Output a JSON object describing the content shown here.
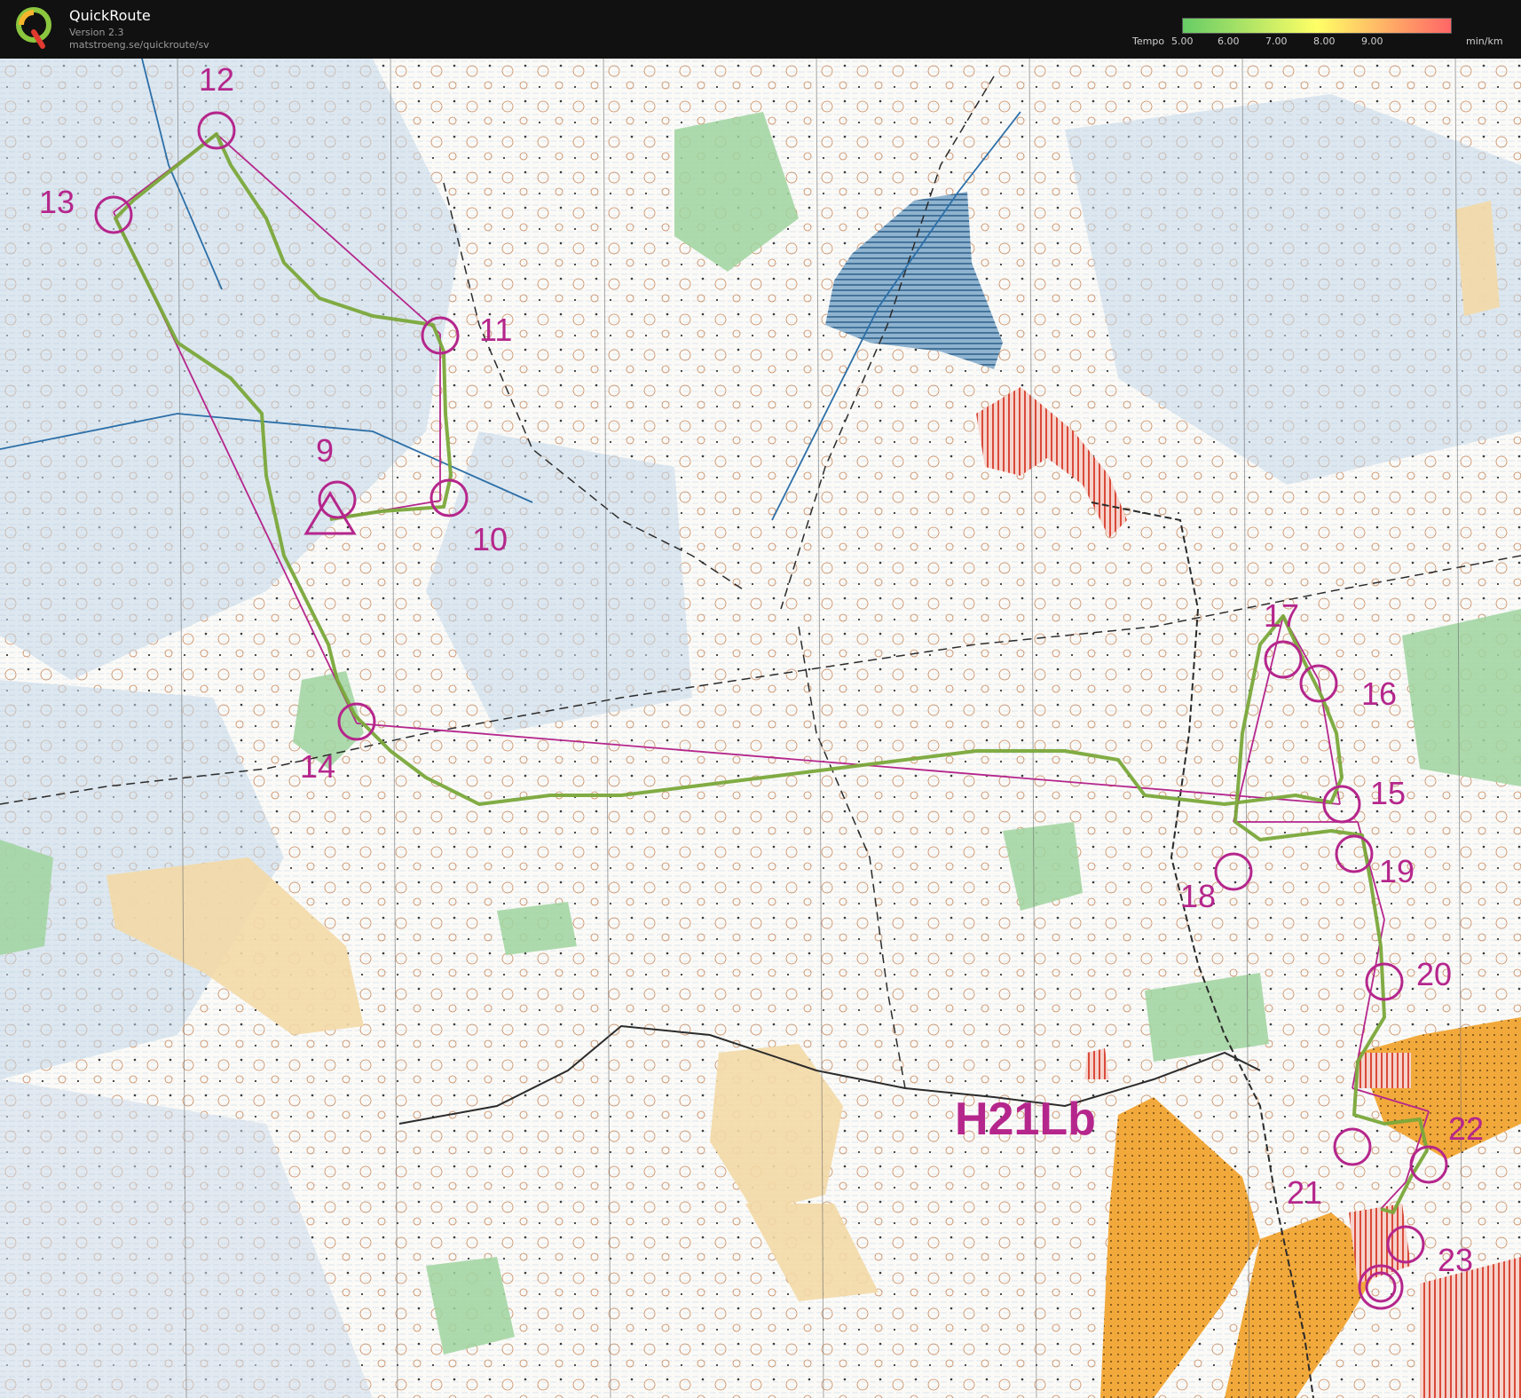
{
  "app": {
    "title": "QuickRoute",
    "version": "Version 2.3",
    "url": "matstroeng.se/quickroute/sv"
  },
  "legend": {
    "label_prefix": "Tempo",
    "ticks": [
      "5.00",
      "6.00",
      "7.00",
      "8.00",
      "9.00"
    ],
    "unit": "min/km",
    "colors": {
      "slow": "#ff6666",
      "mid": "#ffff66",
      "fast": "#66cc66"
    }
  },
  "map": {
    "course_name": "H21Lb",
    "controls": [
      "9",
      "10",
      "11",
      "12",
      "13",
      "14",
      "15",
      "16",
      "17",
      "18",
      "19",
      "20",
      "21",
      "22",
      "23"
    ],
    "colors": {
      "course": "#b5268c",
      "route": "#7aa83a",
      "water": "#2c5f8a",
      "forbidden": "#d94a3a",
      "open_land": "#f2a93b",
      "green": "#8fd08f"
    }
  }
}
